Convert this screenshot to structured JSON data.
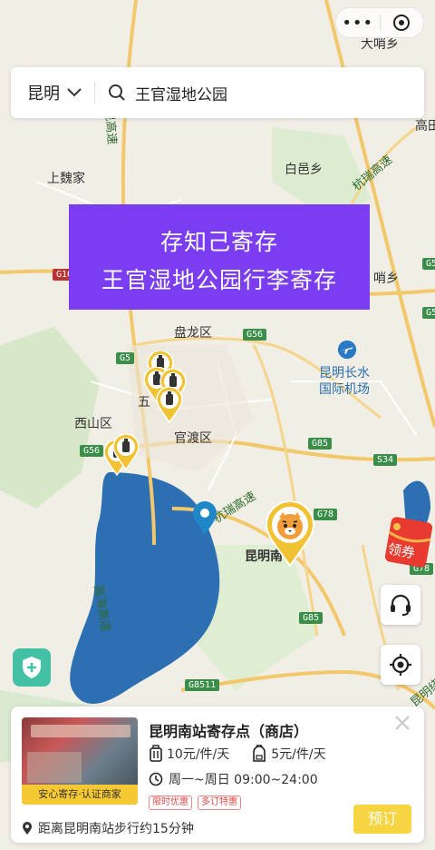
{
  "colors": {
    "accent": "#7a3df1",
    "pin_yellow": "#f1c232",
    "pin_blue": "#1f86c8",
    "book_bg": "#f7d442",
    "shield_green": "#43c1a4"
  },
  "capsule": {
    "menu_icon": "more-dots-icon",
    "close_icon": "target-close-icon"
  },
  "search": {
    "city": "昆明",
    "query": "王官湿地公园",
    "city_icon": "chevron-down-icon",
    "search_icon": "search-icon"
  },
  "banner": {
    "line1": "存知己寄存",
    "line2": "王官湿地公园行李寄存"
  },
  "map_labels": [
    {
      "text": "大哨乡"
    },
    {
      "text": "高田"
    },
    {
      "text": "白邑乡"
    },
    {
      "text": "上魏家"
    },
    {
      "text": "哨乡"
    },
    {
      "text": "盘龙区"
    },
    {
      "text": "西山区"
    },
    {
      "text": "官渡区"
    },
    {
      "text": "五"
    },
    {
      "text": "昆明长水"
    },
    {
      "text": "国际机场"
    },
    {
      "text": "昆明南"
    },
    {
      "text": "杭瑞高速"
    },
    {
      "text": "杭瑞高速"
    },
    {
      "text": "高海高速"
    },
    {
      "text": "昆高速"
    },
    {
      "text": "昆明绕城"
    }
  ],
  "road_shields": [
    "G5",
    "G56",
    "G56",
    "G10",
    "G85",
    "S34",
    "G78",
    "G78",
    "G85",
    "G8511",
    "G56",
    "G5"
  ],
  "card": {
    "store_name": "昆明南站寄存点（商店）",
    "thumb_tag": "安心寄存·认证商家",
    "price_large": "10元/件/天",
    "price_small": "5元/件/天",
    "hours": "周一~周日 09:00~24:00",
    "promo1": "限时优惠",
    "promo2": "多订特惠",
    "distance": "距离昆明南站步行约15分钟",
    "book_label": "预订"
  },
  "red_packet": {
    "label": "领券"
  }
}
